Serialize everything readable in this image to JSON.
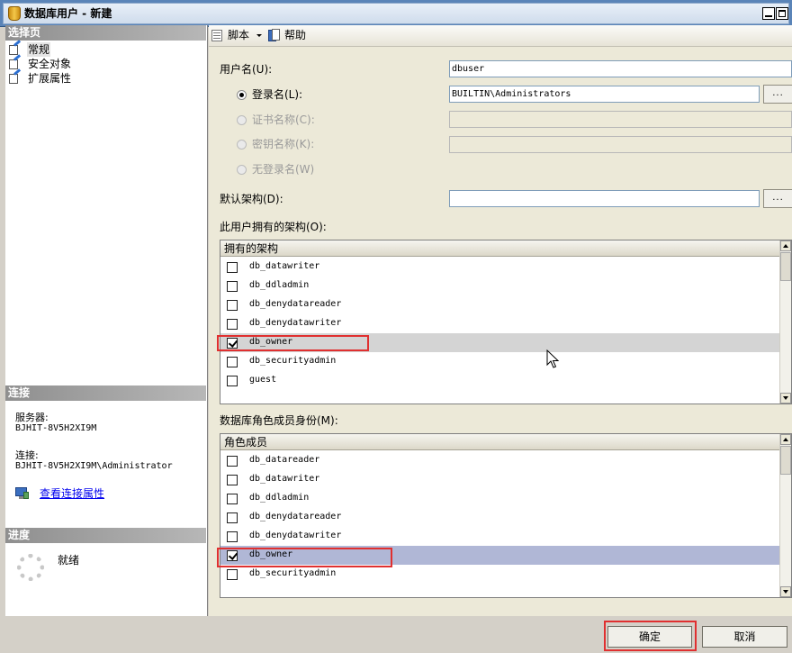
{
  "window": {
    "title": "数据库用户 - 新建"
  },
  "left": {
    "select_page_header": "选择页",
    "nav_items": [
      {
        "label": "常规"
      },
      {
        "label": "安全对象"
      },
      {
        "label": "扩展属性"
      }
    ],
    "connection_header": "连接",
    "server_label": "服务器:",
    "server_value": "BJHIT-8V5H2XI9M",
    "connection_label": "连接:",
    "connection_value": "BJHIT-8V5H2XI9M\\Administrator",
    "view_connection_link": "查看连接属性",
    "progress_header": "进度",
    "progress_status": "就绪"
  },
  "toolbar": {
    "script_label": "脚本",
    "help_label": "帮助"
  },
  "form": {
    "username_label": "用户名(U):",
    "username_value": "dbuser",
    "login_name_label": "登录名(L):",
    "login_name_value": "BUILTIN\\Administrators",
    "cert_name_label": "证书名称(C):",
    "key_name_label": "密钥名称(K):",
    "no_login_label": "无登录名(W)",
    "default_schema_label": "默认架构(D):",
    "default_schema_value": "",
    "browse_label": "...",
    "selected_option": "登录名(L)"
  },
  "owned_schemas": {
    "label": "此用户拥有的架构(O):",
    "column_header": "拥有的架构",
    "rows": [
      {
        "name": "db_datawriter",
        "checked": false
      },
      {
        "name": "db_ddladmin",
        "checked": false
      },
      {
        "name": "db_denydatareader",
        "checked": false
      },
      {
        "name": "db_denydatawriter",
        "checked": false
      },
      {
        "name": "db_owner",
        "checked": true
      },
      {
        "name": "db_securityadmin",
        "checked": false
      },
      {
        "name": "guest",
        "checked": false
      }
    ]
  },
  "role_members": {
    "label": "数据库角色成员身份(M):",
    "column_header": "角色成员",
    "rows": [
      {
        "name": "db_datareader",
        "checked": false
      },
      {
        "name": "db_datawriter",
        "checked": false
      },
      {
        "name": "db_ddladmin",
        "checked": false
      },
      {
        "name": "db_denydatareader",
        "checked": false
      },
      {
        "name": "db_denydatawriter",
        "checked": false
      },
      {
        "name": "db_owner",
        "checked": true
      },
      {
        "name": "db_securityadmin",
        "checked": false
      }
    ]
  },
  "buttons": {
    "ok": "确定",
    "cancel": "取消"
  },
  "colors": {
    "highlight_box": "#e03030",
    "selected_row_blue": "#b0b7d6",
    "selected_row_gray": "#d4d4d4",
    "link": "#0000ee"
  }
}
